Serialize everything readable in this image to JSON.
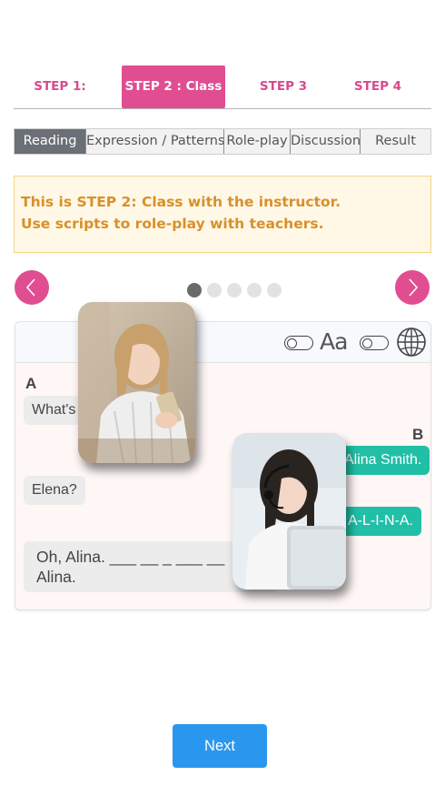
{
  "steps": [
    {
      "label": "STEP 1:",
      "active": false
    },
    {
      "label": "STEP 2 : Class",
      "active": true
    },
    {
      "label": "STEP 3",
      "active": false
    },
    {
      "label": "STEP 4",
      "active": false
    }
  ],
  "subtabs": [
    {
      "label": "Reading",
      "active": true
    },
    {
      "label": "Expression / Patterns",
      "active": false
    },
    {
      "label": "Role-play",
      "active": false
    },
    {
      "label": "Discussion",
      "active": false
    },
    {
      "label": "Result",
      "active": false
    }
  ],
  "notice": {
    "line1": "This is STEP 2: Class with the instructor.",
    "line2": "Use scripts to role-play with teachers."
  },
  "carousel": {
    "page_count": 5,
    "current_page": 1,
    "prev_icon": "chevron-left-icon",
    "next_icon": "chevron-right-icon"
  },
  "toolbar": {
    "font_size_label": "Aa",
    "toggle1_icon": "toggle-icon",
    "toggle2_icon": "toggle-icon",
    "language_icon": "globe-icon"
  },
  "dialogue": {
    "speaker_a": "A",
    "speaker_b": "B",
    "lines": [
      {
        "speaker": "A",
        "text": "What's"
      },
      {
        "speaker": "B",
        "text": "Alina Smith."
      },
      {
        "speaker": "A",
        "text": "Elena?"
      },
      {
        "speaker": "B",
        "text": "A-L-I-N-A."
      },
      {
        "speaker": "A",
        "line1": "Oh, Alina. ___ __ _ ___ __",
        "line2": "Alina."
      }
    ]
  },
  "next_button": "Next",
  "colors": {
    "accent_pink": "#e04e91",
    "bubble_teal": "#21bfa6",
    "next_blue": "#2a97ee",
    "notice_text": "#d8902b"
  }
}
